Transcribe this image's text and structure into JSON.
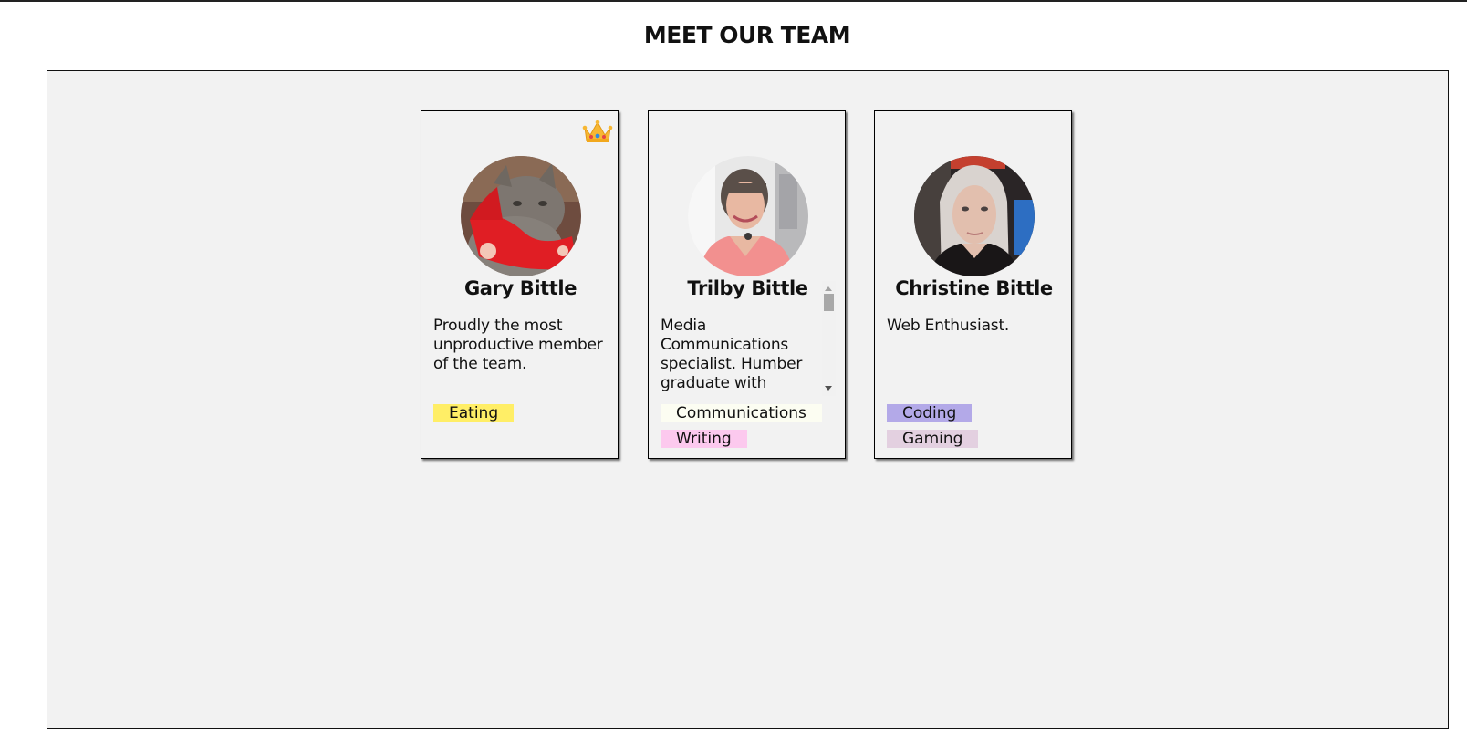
{
  "page": {
    "title": "MEET OUR TEAM"
  },
  "colors": {
    "panel_background": "#f2f2f2",
    "tag_eating": "#ffee66",
    "tag_communications": "#fcfdf2",
    "tag_writing": "#fcc9ee",
    "tag_coding": "#b3a9e8",
    "tag_gaming": "#e3d0e0"
  },
  "members": [
    {
      "name": "Gary Bittle",
      "bio": "Proudly the most unproductive member of the team.",
      "badge_icon": "crown-icon",
      "avatar": "cat-photo",
      "tags": [
        {
          "label": "Eating",
          "color": "#ffee66"
        }
      ]
    },
    {
      "name": "Trilby Bittle",
      "bio": "Media Communications specialist. Humber graduate with",
      "avatar": "woman-photo",
      "tags": [
        {
          "label": "Communications",
          "color": "#fcfdf2"
        },
        {
          "label": "Writing",
          "color": "#fcc9ee"
        }
      ]
    },
    {
      "name": "Christine Bittle",
      "bio": "Web Enthusiast.",
      "avatar": "woman-photo",
      "tags": [
        {
          "label": "Coding",
          "color": "#b3a9e8"
        },
        {
          "label": "Gaming",
          "color": "#e3d0e0"
        }
      ]
    }
  ]
}
